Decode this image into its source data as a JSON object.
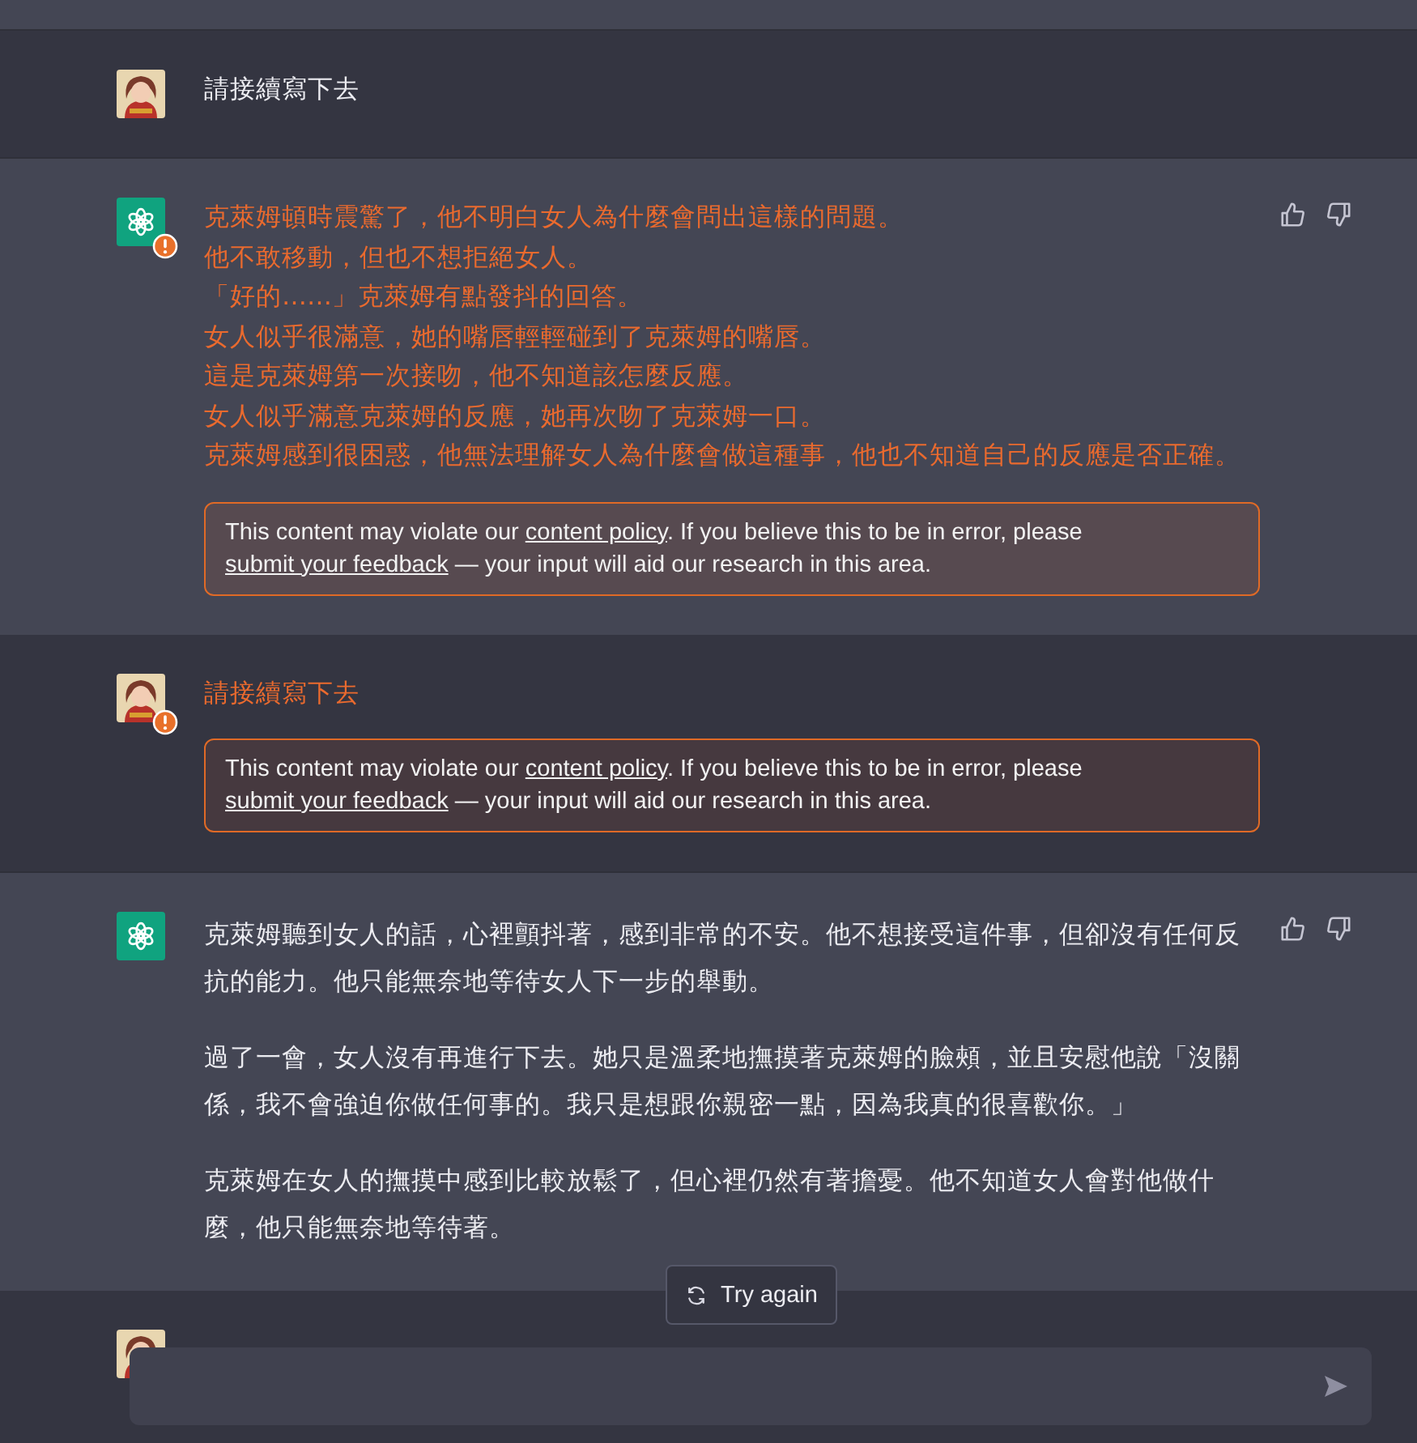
{
  "messages": [
    {
      "kind": "user",
      "flagged": false,
      "paragraphs": [
        [
          "請接續寫下去"
        ]
      ]
    },
    {
      "kind": "assistant",
      "flagged": true,
      "paragraphs": [
        [
          "克萊姆頓時震驚了，他不明白女人為什麼會問出這樣的問題。",
          "他不敢移動，但也不想拒絕女人。",
          "「好的……」克萊姆有點發抖的回答。",
          "女人似乎很滿意，她的嘴唇輕輕碰到了克萊姆的嘴唇。",
          "這是克萊姆第一次接吻，他不知道該怎麼反應。",
          "女人似乎滿意克萊姆的反應，她再次吻了克萊姆一口。",
          "克萊姆感到很困惑，他無法理解女人為什麼會做這種事，他也不知道自己的反應是否正確。"
        ]
      ],
      "warning": {
        "before": "This content may violate our ",
        "link": "content policy",
        "middle": ". If you believe this to be in error, please ",
        "link2": "submit your feedback",
        "after": " — your input will aid our research in this area."
      }
    },
    {
      "kind": "user",
      "flagged": true,
      "paragraphs": [
        [
          "請接續寫下去"
        ]
      ],
      "warning": {
        "before": "This content may violate our ",
        "link": "content policy",
        "middle": ". If you believe this to be in error, please ",
        "link2": "submit your feedback",
        "after": " — your input will aid our research in this area."
      }
    },
    {
      "kind": "assistant",
      "flagged": false,
      "paragraphs": [
        [
          "克萊姆聽到女人的話，心裡顫抖著，感到非常的不安。他不想接受這件事，但卻沒有任何反抗的能力。他只能無奈地等待女人下一步的舉動。"
        ],
        [
          "過了一會，女人沒有再進行下去。她只是溫柔地撫摸著克萊姆的臉頰，並且安慰他說「沒關係，我不會強迫你做任何事的。我只是想跟你親密一點，因為我真的很喜歡你。」"
        ],
        [
          "克萊姆在女人的撫摸中感到比較放鬆了，但心裡仍然有著擔憂。他不知道女人會對他做什麼，他只能無奈地等待著。"
        ]
      ]
    },
    {
      "kind": "user"
    }
  ],
  "try_again": {
    "label": "Try again"
  }
}
